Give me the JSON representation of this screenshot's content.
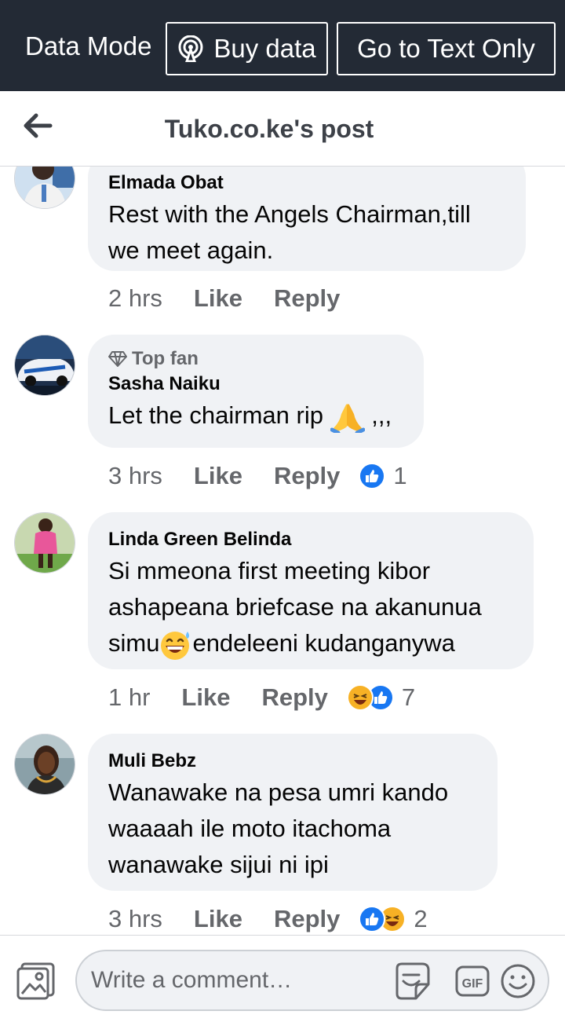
{
  "data_mode": {
    "label": "Data Mode",
    "buy_data": "Buy data",
    "text_only": "Go to Text Only"
  },
  "header": {
    "title": "Tuko.co.ke's post"
  },
  "comments": [
    {
      "author": "Elmada Obat",
      "lines": [
        "Rest with the Angels Chairman,till",
        "we meet again."
      ],
      "time": "2 hrs",
      "like": "Like",
      "reply": "Reply"
    },
    {
      "badge": "Top fan",
      "author": "Sasha Naiku",
      "text_before": "Let the chairman rip",
      "emoji": "folded-hands",
      "text_after": ",,,",
      "time": "3 hrs",
      "like": "Like",
      "reply": "Reply",
      "reactions": [
        "like"
      ],
      "reaction_count": "1"
    },
    {
      "author": "Linda Green Belinda",
      "lines": [
        "Si mmeona first meeting kibor",
        "ashapeana briefcase na akanunua"
      ],
      "line3_before": "simu",
      "line3_emoji": "grinning-sweat",
      "line3_after": "endeleeni kudanganywa",
      "time": "1 hr",
      "like": "Like",
      "reply": "Reply",
      "reactions": [
        "haha",
        "like"
      ],
      "reaction_count": "7"
    },
    {
      "author": "Muli Bebz",
      "lines": [
        "Wanawake na pesa umri kando",
        "waaaah ile moto itachoma",
        "wanawake sijui ni ipi"
      ],
      "time": "3 hrs",
      "like": "Like",
      "reply": "Reply",
      "reactions": [
        "like",
        "haha"
      ],
      "reaction_count": "2"
    }
  ],
  "composer": {
    "placeholder": "Write a comment…"
  },
  "colors": {
    "data_bar_bg": "#232a35",
    "bubble_bg": "#f0f2f5",
    "like_blue": "#1877f2",
    "haha_yellow": "#f7b125",
    "secondary_text": "#65676b"
  }
}
